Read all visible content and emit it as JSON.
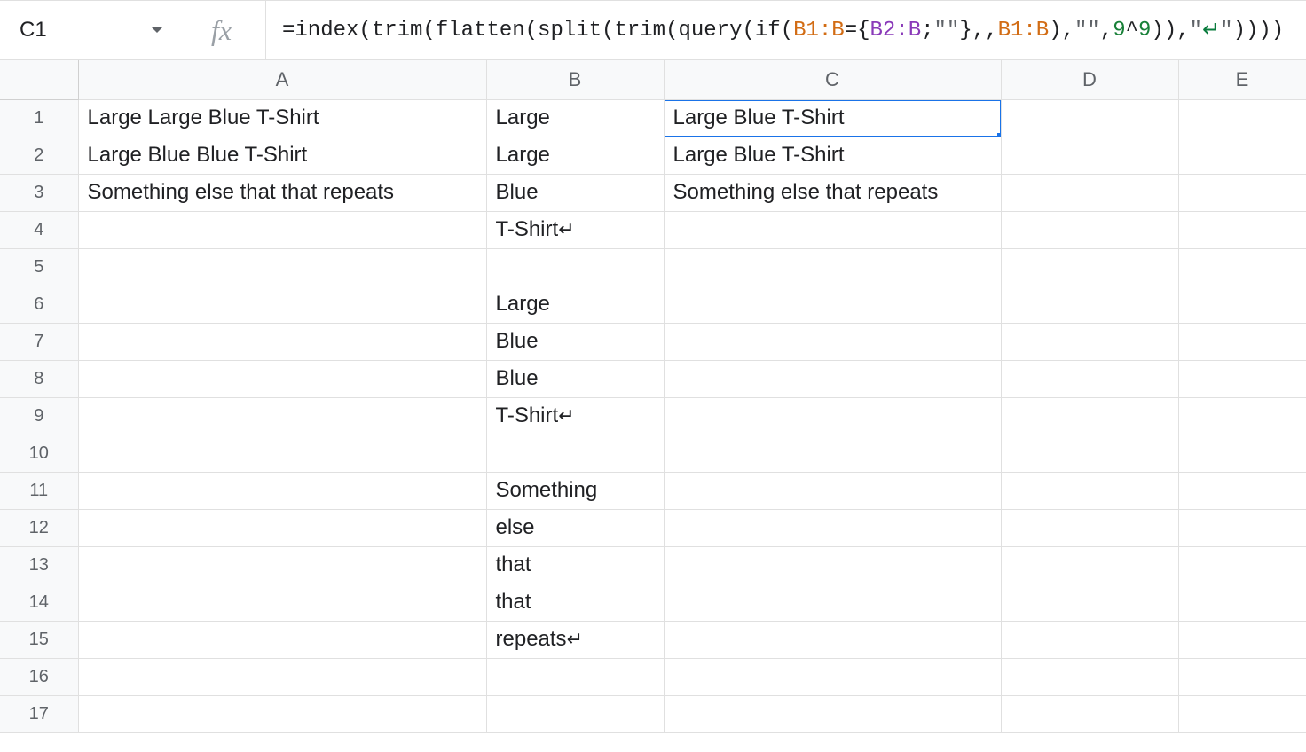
{
  "namebox": {
    "cell_ref": "C1"
  },
  "fx_label": "fx",
  "formula": {
    "parts": [
      {
        "t": "=index(trim(flatten(split(trim(query(if(",
        "c": ""
      },
      {
        "t": "B1:B",
        "c": "c-orange"
      },
      {
        "t": "=",
        "c": ""
      },
      {
        "t": "{",
        "c": ""
      },
      {
        "t": "B2:B",
        "c": "c-purple"
      },
      {
        "t": ";",
        "c": ""
      },
      {
        "t": "\"\"",
        "c": "c-gray"
      },
      {
        "t": "},,",
        "c": ""
      },
      {
        "t": "B1:B",
        "c": "c-orange"
      },
      {
        "t": "),",
        "c": ""
      },
      {
        "t": "\"\"",
        "c": "c-gray"
      },
      {
        "t": ",",
        "c": ""
      },
      {
        "t": "9",
        "c": "c-teal"
      },
      {
        "t": "^",
        "c": ""
      },
      {
        "t": "9",
        "c": "c-teal"
      },
      {
        "t": ")),",
        "c": ""
      },
      {
        "t": "\"",
        "c": "c-gray"
      },
      {
        "t": "↵",
        "c": "enter-glyph"
      },
      {
        "t": "\"",
        "c": "c-gray"
      },
      {
        "t": "))))",
        "c": ""
      }
    ]
  },
  "columns": [
    "A",
    "B",
    "C",
    "D",
    "E"
  ],
  "row_count": 17,
  "selection": {
    "col": "C",
    "row": 1
  },
  "cells": {
    "A": {
      "1": "Large Large Blue T-Shirt",
      "2": "Large Blue Blue T-Shirt",
      "3": "Something else that that repeats"
    },
    "B": {
      "1": "Large",
      "2": "Large",
      "3": "Blue",
      "4": "T-Shirt↵",
      "6": "Large",
      "7": "Blue",
      "8": "Blue",
      "9": "T-Shirt↵",
      "11": "Something",
      "12": "else",
      "13": "that",
      "14": "that",
      "15": "repeats↵"
    },
    "C": {
      "1": "Large Blue T-Shirt",
      "2": "Large Blue T-Shirt",
      "3": "Something else that repeats"
    },
    "D": {},
    "E": {}
  },
  "icons": {
    "return_glyph": "↵"
  }
}
